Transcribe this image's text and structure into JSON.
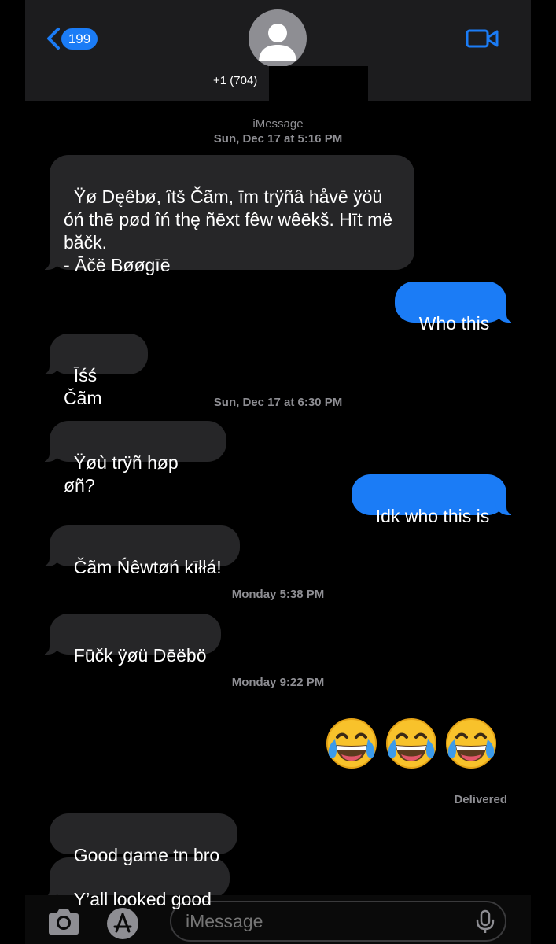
{
  "header": {
    "unread_count": "199",
    "contact_name": "+1 (704)"
  },
  "thread": {
    "service_label": "iMessage",
    "stamps": {
      "s1": "Sun, Dec 17 at 5:16 PM",
      "s2": "Sun, Dec 17 at 6:30 PM",
      "s3": "Monday 5:38 PM",
      "s4": "Monday 9:22 PM"
    },
    "messages": [
      {
        "from": "them",
        "text": "Ÿø Dęêbø, îtš Čãm, īm trÿñâ håvē ÿöü óń thē pød îń thę ñēxt fêw wêēkš. Hīt më băčk.\n- Āčë Bøøgīē"
      },
      {
        "from": "me",
        "text": "Who this"
      },
      {
        "from": "them",
        "text": "Īśś Čãm"
      },
      {
        "from": "them",
        "text": "Ÿøù trÿñ høp øñ?"
      },
      {
        "from": "me",
        "text": "Idk who this is"
      },
      {
        "from": "them",
        "text": "Čãm Ńêwtøń kīłłá!"
      },
      {
        "from": "them",
        "text": "Fūčk ÿøü Dēëbö"
      },
      {
        "from": "me",
        "text": "😂😂😂"
      },
      {
        "from": "them",
        "text": "Good game tn bro"
      },
      {
        "from": "them",
        "text": "Y’all looked good"
      }
    ],
    "status": "Delivered"
  },
  "composer": {
    "placeholder": "iMessage"
  },
  "colors": {
    "accent": "#1b7cf6",
    "incoming_bubble": "#262628",
    "header_bg": "#1c1c1e"
  },
  "icons": [
    "chevron-left-icon",
    "video-camera-icon",
    "person-icon",
    "camera-icon",
    "app-store-icon",
    "microphone-icon",
    "face-with-tears-of-joy-emoji"
  ]
}
